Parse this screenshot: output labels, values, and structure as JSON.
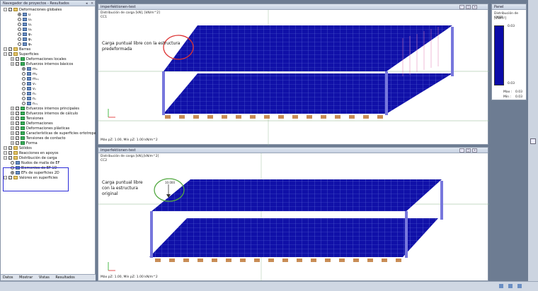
{
  "navigator": {
    "title": "Navegador de proyectos - Resultados",
    "items": [
      {
        "label": "Deformaciones globales",
        "depth": 0,
        "kind": "cb-folder"
      },
      {
        "label": "u",
        "depth": 2,
        "kind": "radio-on"
      },
      {
        "label": "uₓ",
        "depth": 2,
        "kind": "radio"
      },
      {
        "label": "uᵧ",
        "depth": 2,
        "kind": "radio"
      },
      {
        "label": "uₔ",
        "depth": 2,
        "kind": "radio"
      },
      {
        "label": "φₓ",
        "depth": 2,
        "kind": "radio"
      },
      {
        "label": "φᵧ",
        "depth": 2,
        "kind": "radio"
      },
      {
        "label": "φₔ",
        "depth": 2,
        "kind": "radio"
      },
      {
        "label": "Barras",
        "depth": 0,
        "kind": "cb-folder"
      },
      {
        "label": "Superficies",
        "depth": 0,
        "kind": "cb-folder"
      },
      {
        "label": "Deformaciones locales",
        "depth": 1,
        "kind": "cb-green"
      },
      {
        "label": "Esfuerzos internos básicos",
        "depth": 1,
        "kind": "cb-green"
      },
      {
        "label": "mₓ",
        "depth": 3,
        "kind": "radio-on"
      },
      {
        "label": "mᵧ",
        "depth": 3,
        "kind": "radio"
      },
      {
        "label": "mₓᵧ",
        "depth": 3,
        "kind": "radio"
      },
      {
        "label": "vₓ",
        "depth": 3,
        "kind": "radio"
      },
      {
        "label": "vᵧ",
        "depth": 3,
        "kind": "radio"
      },
      {
        "label": "nₓ",
        "depth": 3,
        "kind": "radio"
      },
      {
        "label": "nᵧ",
        "depth": 3,
        "kind": "radio"
      },
      {
        "label": "nₓᵧ",
        "depth": 3,
        "kind": "radio"
      },
      {
        "label": "Esfuerzos internos principales",
        "depth": 1,
        "kind": "cb-green"
      },
      {
        "label": "Esfuerzos internos de cálculo",
        "depth": 1,
        "kind": "cb-green"
      },
      {
        "label": "Tensiones",
        "depth": 1,
        "kind": "cb-green"
      },
      {
        "label": "Deformaciones",
        "depth": 1,
        "kind": "cb-green"
      },
      {
        "label": "Deformaciones plásticas",
        "depth": 1,
        "kind": "cb-green"
      },
      {
        "label": "Características de superficies ortotropas",
        "depth": 1,
        "kind": "cb-green"
      },
      {
        "label": "Tensiones de contacto",
        "depth": 1,
        "kind": "cb-green"
      },
      {
        "label": "Forma",
        "depth": 1,
        "kind": "cb-green"
      },
      {
        "label": "Sólidos",
        "depth": 0,
        "kind": "cb-folder"
      },
      {
        "label": "Reacciones en apoyos",
        "depth": 0,
        "kind": "cb-folder"
      },
      {
        "label": "Distribución de carga",
        "depth": 0,
        "kind": "cb-folder"
      },
      {
        "label": "Nudos de malla de EF",
        "depth": 1,
        "kind": "radio"
      },
      {
        "label": "Elementos de EF 1D",
        "depth": 1,
        "kind": "radio"
      },
      {
        "label": "EFs de superficies 2D",
        "depth": 1,
        "kind": "radio-on"
      },
      {
        "label": "Valores en superficies",
        "depth": 0,
        "kind": "cb-folder"
      }
    ],
    "tabs": [
      "Datos",
      "Mostrar",
      "Vistas",
      "Resultados"
    ]
  },
  "view_top": {
    "title": "imperfektionen-test",
    "info_line1": "Distribución de carga [kN], [kN/m^2]",
    "info_line2": "CC1",
    "annotation": "Carga puntual libre con la estructura predeformada",
    "footer": "Máx pZ: 1.00, Mín pZ: 1.00 kN/m^2"
  },
  "view_bottom": {
    "title": "imperfektionen-test",
    "info_line1": "Distribución de carga [kN],[kN/m^2]",
    "info_line2": "CC2",
    "annotation": "Carga puntual libre con la estructura original",
    "point_load": "10.000",
    "footer": "Máx pZ: 1.00, Mín pZ: 1.00 kN/m^2"
  },
  "panel": {
    "title": "Panel",
    "subtitle": "Distribución de carga",
    "unit": "[kN/m²]",
    "top_value": "0.03",
    "bottom_value": "0.03",
    "max_label": "Max :",
    "max_value": "0.03",
    "min_label": "Min :",
    "min_value": "0.03"
  },
  "colors": {
    "slab": "#1010a8",
    "mesh": "#5b6ad8",
    "column": "#7777dd",
    "support": "#c88c55",
    "circle_red": "#dd3333",
    "circle_green": "#55aa44",
    "highlight": "#2a2ad8"
  }
}
